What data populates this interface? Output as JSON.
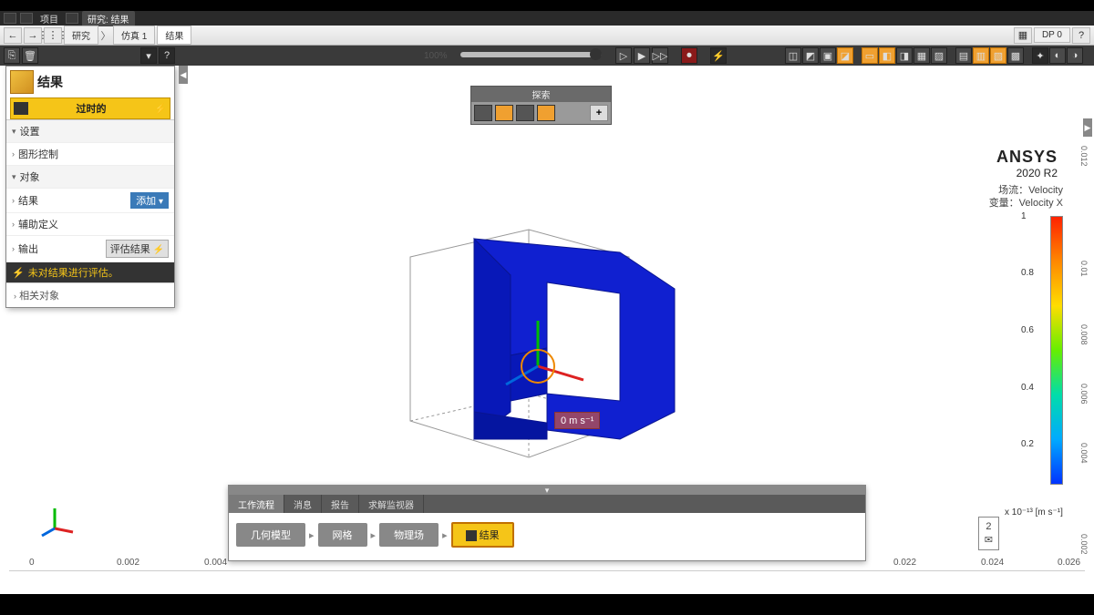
{
  "titlebar": {
    "project": "项目",
    "study": "研究: 结果"
  },
  "nav": {
    "study": "研究",
    "sim": "仿真 1",
    "result": "结果",
    "dp": "DP 0"
  },
  "toolbar": {
    "zoom": "100%"
  },
  "leftpanel": {
    "title": "结果",
    "status": "过时的",
    "settings": "设置",
    "graphics": "图形控制",
    "objects": "对象",
    "results": "结果",
    "add": "添加",
    "auxdef": "辅助定义",
    "output": "输出",
    "eval": "评估结果",
    "warn": "未对结果进行评估。",
    "related": "相关对象"
  },
  "explore": {
    "title": "探索",
    "plus": "+"
  },
  "ansys": {
    "name": "ANSYS",
    "ver": "2020 R2"
  },
  "field": {
    "scene": "场流：Velocity",
    "var": "变量：Velocity X"
  },
  "legend": {
    "ticks": [
      "1",
      "0.8",
      "0.6",
      "0.4",
      "0.2"
    ],
    "rticks": [
      "0.01",
      "0.008",
      "0.006",
      "0.004",
      "0.002"
    ],
    "unit": "x 10⁻¹³ [m s⁻¹]"
  },
  "valuelabel": "0 m s⁻¹",
  "bottom": {
    "tabs": [
      "工作流程",
      "消息",
      "报告",
      "求解监视器"
    ],
    "steps": [
      "几何模型",
      "网格",
      "物理场",
      "结果"
    ]
  },
  "ruler": {
    "h": [
      "0",
      "0.002",
      "0.004",
      "0.022",
      "0.024",
      "0.026"
    ]
  },
  "vruler": [
    "0.012",
    "0.002"
  ],
  "msgcount": "2"
}
